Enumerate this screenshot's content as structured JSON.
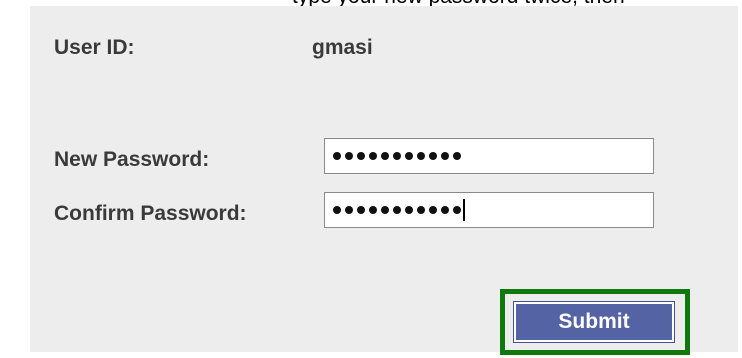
{
  "header_fragment": "type your new password twice, then",
  "form": {
    "user_id_label": "User ID:",
    "user_id_value": "gmasi",
    "new_password_label": "New Password:",
    "new_password_masked": "●●●●●●●●●●●",
    "new_password_length": 11,
    "confirm_password_label": "Confirm Password:",
    "confirm_password_masked": "●●●●●●●●●●●",
    "confirm_password_length": 11,
    "submit_label": "Submit"
  },
  "colors": {
    "panel_bg": "#ededed",
    "submit_bg": "#5363a3",
    "focus_ring": "#0e7a0e"
  }
}
